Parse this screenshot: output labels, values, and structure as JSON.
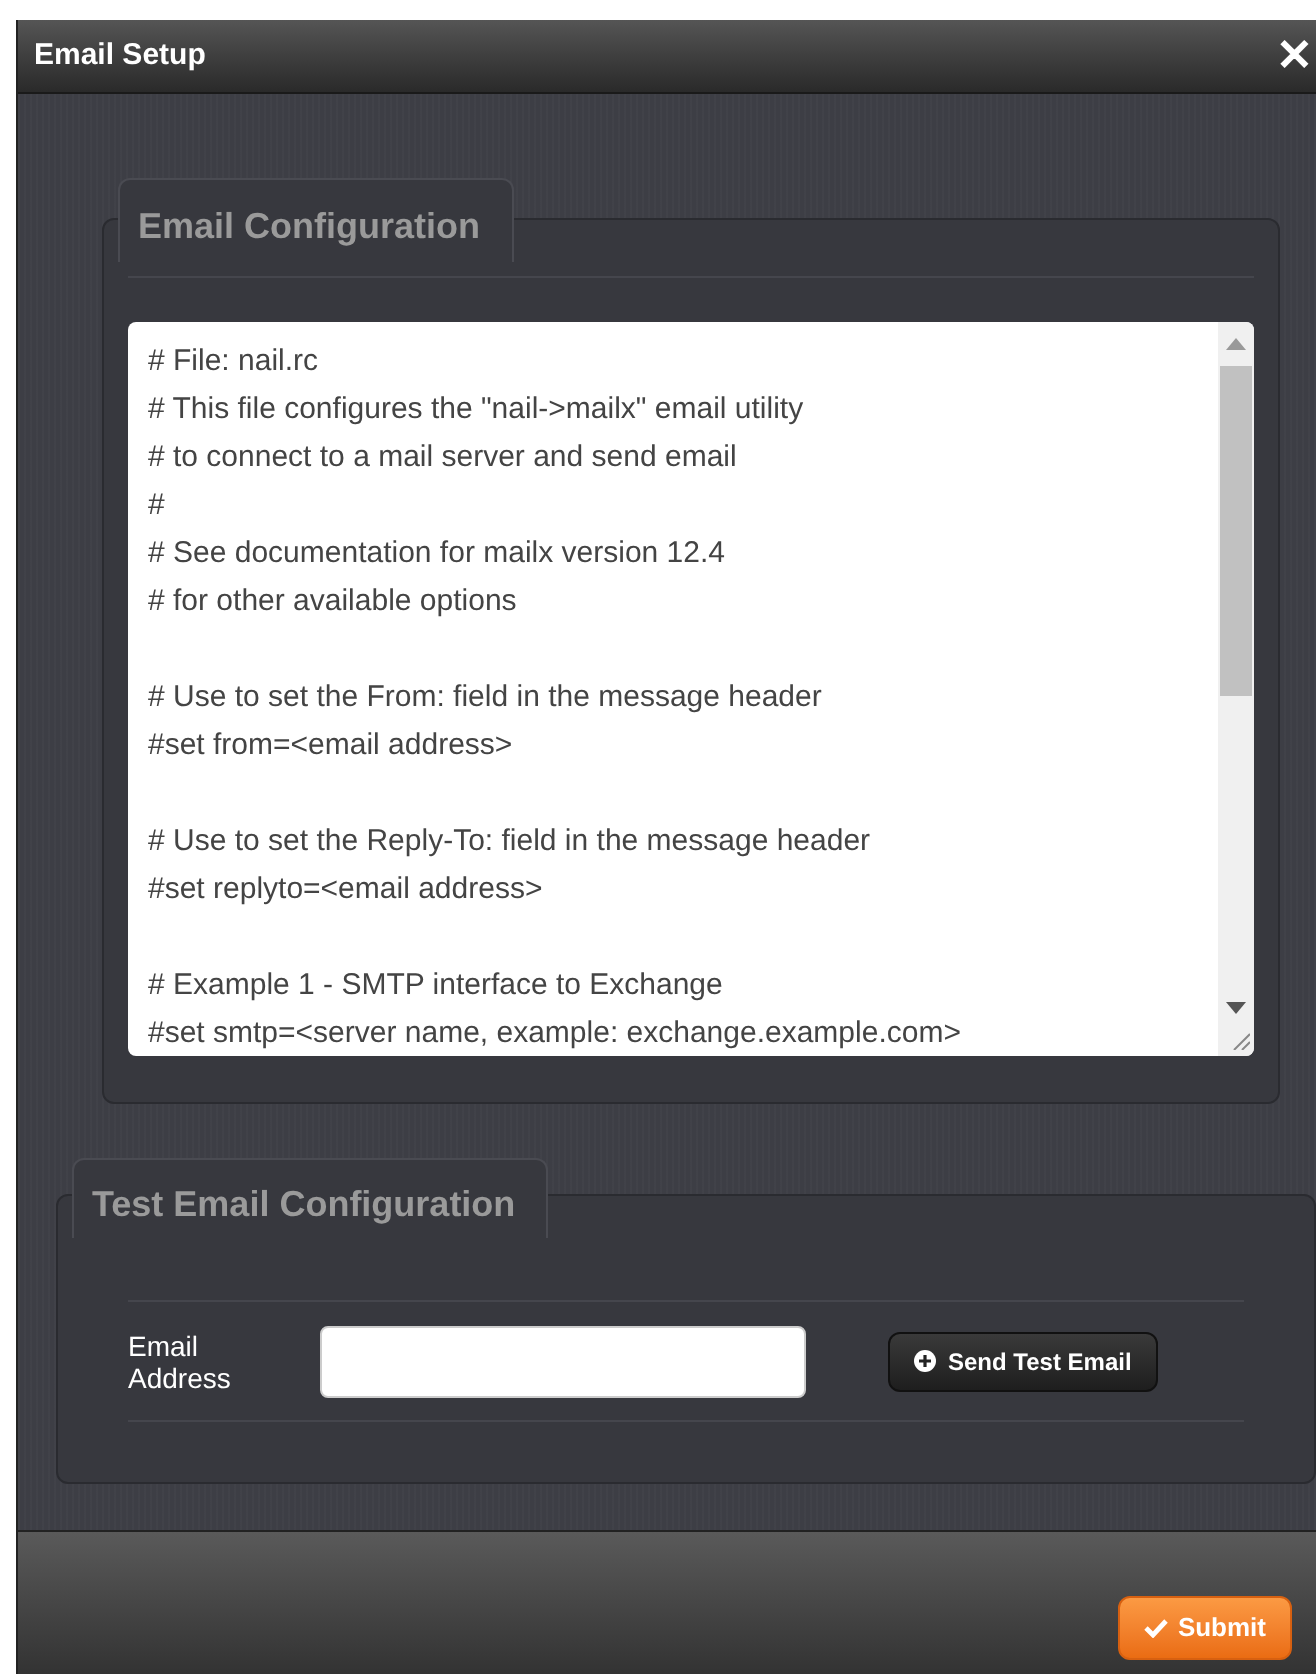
{
  "dialog": {
    "title": "Email Setup",
    "close": "✕"
  },
  "email_configuration": {
    "legend": "Email Configuration",
    "config_blocks": [
      [
        "# File: nail.rc",
        "# This file configures the \"nail->mailx\" email utility",
        "# to connect to a mail server and send email",
        "#",
        "# See documentation for mailx version 12.4",
        "# for other available options"
      ],
      [
        "# Use to set the From: field in the message header",
        "#set from=<email address>"
      ],
      [
        "# Use to set the Reply-To: field in the message header",
        "#set replyto=<email address>"
      ],
      [
        "# Example 1 - SMTP interface to Exchange",
        "#set smtp=<server name, example: exchange.example.com>"
      ]
    ]
  },
  "test_email": {
    "legend": "Test Email Configuration",
    "label": "Email Address",
    "button": "Send Test Email"
  },
  "footer": {
    "submit": "Submit"
  }
}
